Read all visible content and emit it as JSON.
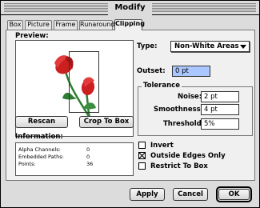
{
  "window": {
    "title": "Modify"
  },
  "tabs": [
    {
      "label": "Box"
    },
    {
      "label": "Picture"
    },
    {
      "label": "Frame"
    },
    {
      "label": "Runaround"
    },
    {
      "label": "Clipping",
      "active": true
    }
  ],
  "preview": {
    "label": "Preview:",
    "rescan_label": "Rescan",
    "crop_label": "Crop To Box"
  },
  "information": {
    "label": "Information:",
    "rows": [
      {
        "name": "Alpha Channels:",
        "value": "0"
      },
      {
        "name": "Embedded Paths:",
        "value": "0"
      },
      {
        "name": "Points:",
        "value": "36"
      }
    ]
  },
  "type": {
    "label": "Type:",
    "value": "Non-White Areas"
  },
  "outset": {
    "label": "Outset:",
    "value": "0  pt"
  },
  "tolerance": {
    "label": "Tolerance",
    "noise_label": "Noise:",
    "noise_value": "2  pt",
    "smoothness_label": "Smoothness:",
    "smoothness_value": "4  pt",
    "threshold_label": "Threshold:",
    "threshold_value": "5%"
  },
  "options": {
    "invert_label": "Invert",
    "invert_checked": false,
    "outside_edges_label": "Outside Edges Only",
    "outside_edges_checked": true,
    "restrict_label": "Restrict To Box",
    "restrict_checked": false
  },
  "buttons": {
    "apply": "Apply",
    "cancel": "Cancel",
    "ok": "OK"
  },
  "colors": {
    "selection": "#aac8ff",
    "tulip_red": "#cc1f1f",
    "stem_green": "#2e7d32"
  }
}
